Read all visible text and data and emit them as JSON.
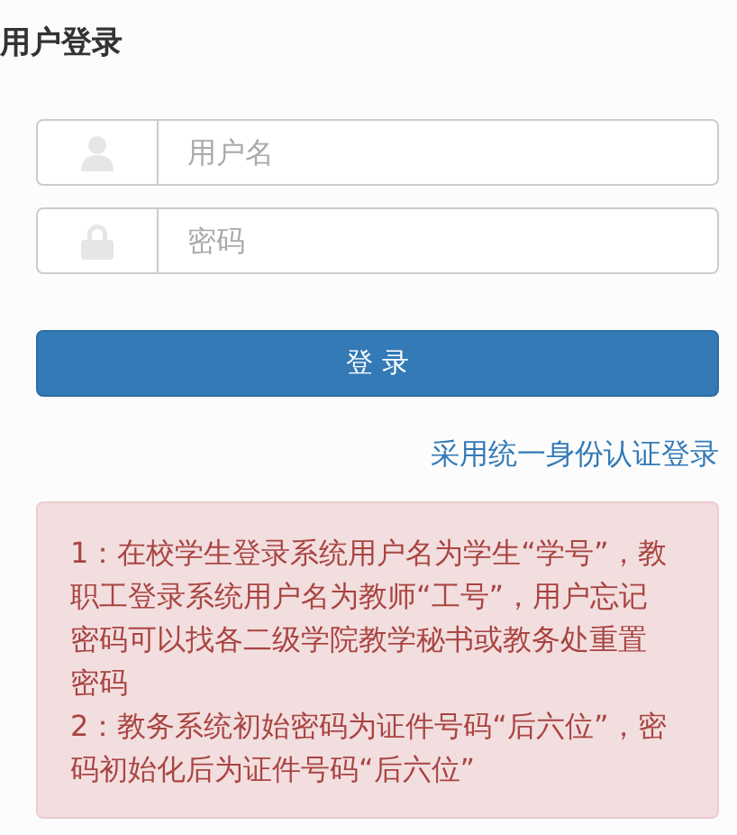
{
  "title": "用户登录",
  "fields": [
    {
      "kind": "user",
      "placeholder": "用户名"
    },
    {
      "kind": "lock",
      "placeholder": "密码"
    }
  ],
  "login_button": "登 录",
  "sso_link": "采用统一身份认证登录",
  "notice": [
    "1：在校学生登录系统用户名为学生“学号”，教职工登录系统用户名为教师“工号”，用户忘记密码可以找各二级学院教学秘书或教务处重置密码",
    "2：教务系统初始密码为证件号码“后六位”，密码初始化后为证件号码“后六位”"
  ]
}
